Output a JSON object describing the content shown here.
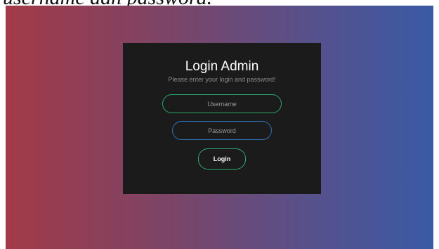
{
  "caption": "username dan password.",
  "card": {
    "title": "Login Admin",
    "subtitle": "Please enter your login and password!"
  },
  "form": {
    "username_placeholder": "Username",
    "password_placeholder": "Password",
    "login_label": "Login"
  },
  "colors": {
    "gradient_left": "#a23a48",
    "gradient_right": "#3a5aa6",
    "card_background": "#1b1b1b",
    "username_border": "#27a86a",
    "password_border": "#2b74b6",
    "button_border": "#2ea86c"
  }
}
